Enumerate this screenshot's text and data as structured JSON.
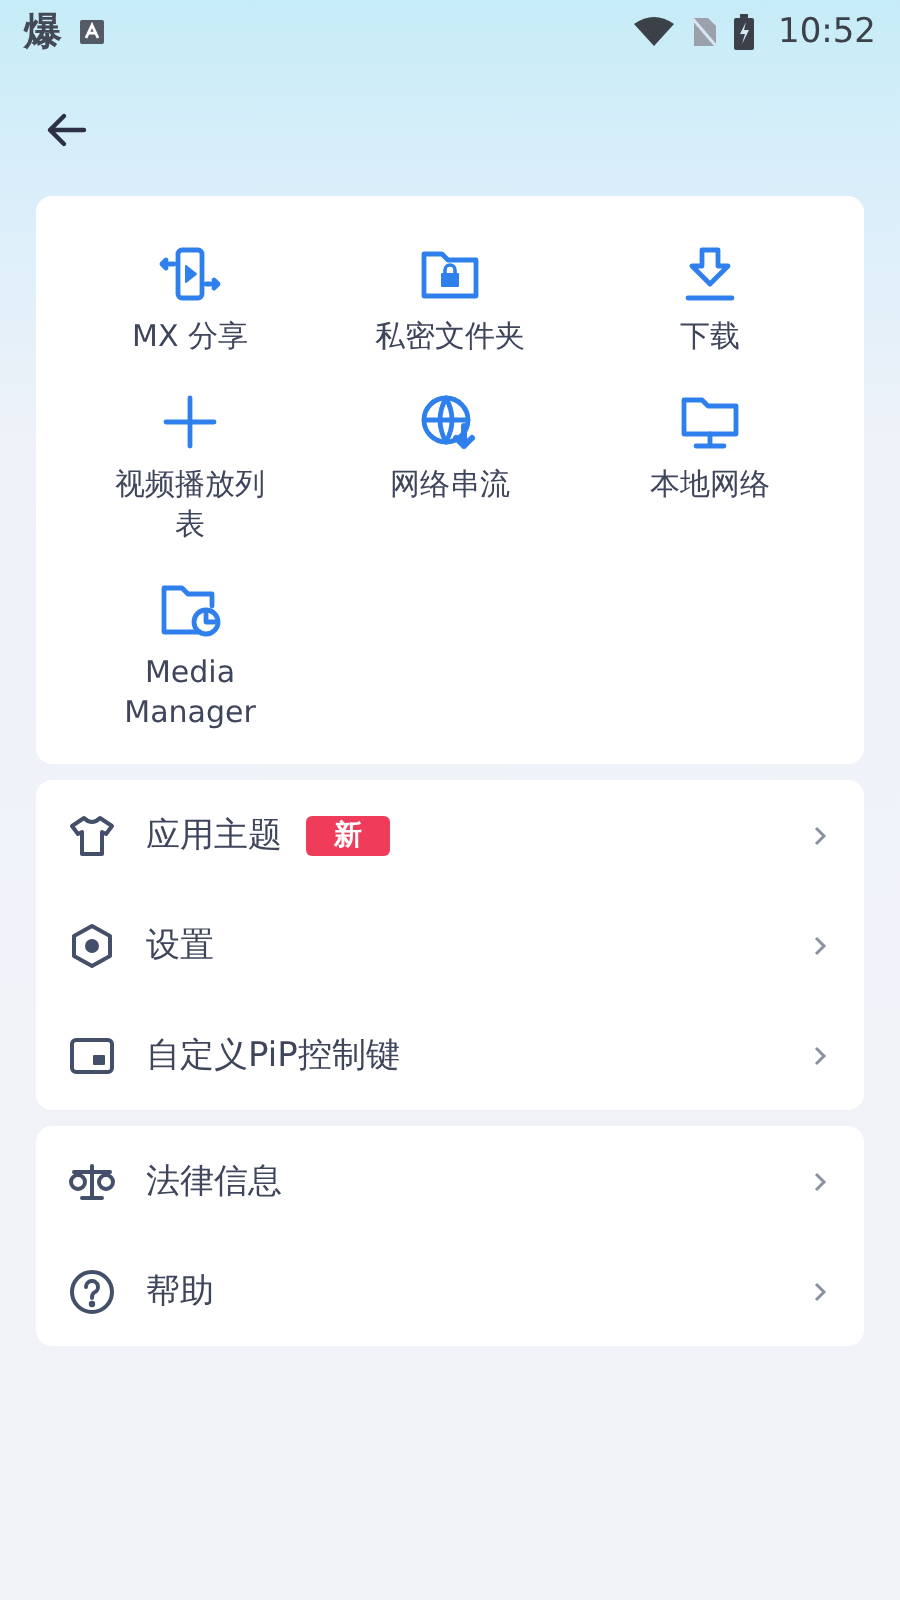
{
  "status_bar": {
    "app_glyph": "爆",
    "time": "10:52"
  },
  "shortcuts": [
    {
      "label": "MX 分享"
    },
    {
      "label": "私密文件夹"
    },
    {
      "label": "下载"
    },
    {
      "label": "视频播放列表"
    },
    {
      "label": "网络串流"
    },
    {
      "label": "本地网络"
    },
    {
      "label": "Media Manager"
    }
  ],
  "settings_items": [
    {
      "label": "应用主题",
      "badge": "新"
    },
    {
      "label": "设置"
    },
    {
      "label": "自定义PiP控制键"
    }
  ],
  "info_items": [
    {
      "label": "法律信息"
    },
    {
      "label": "帮助"
    }
  ]
}
